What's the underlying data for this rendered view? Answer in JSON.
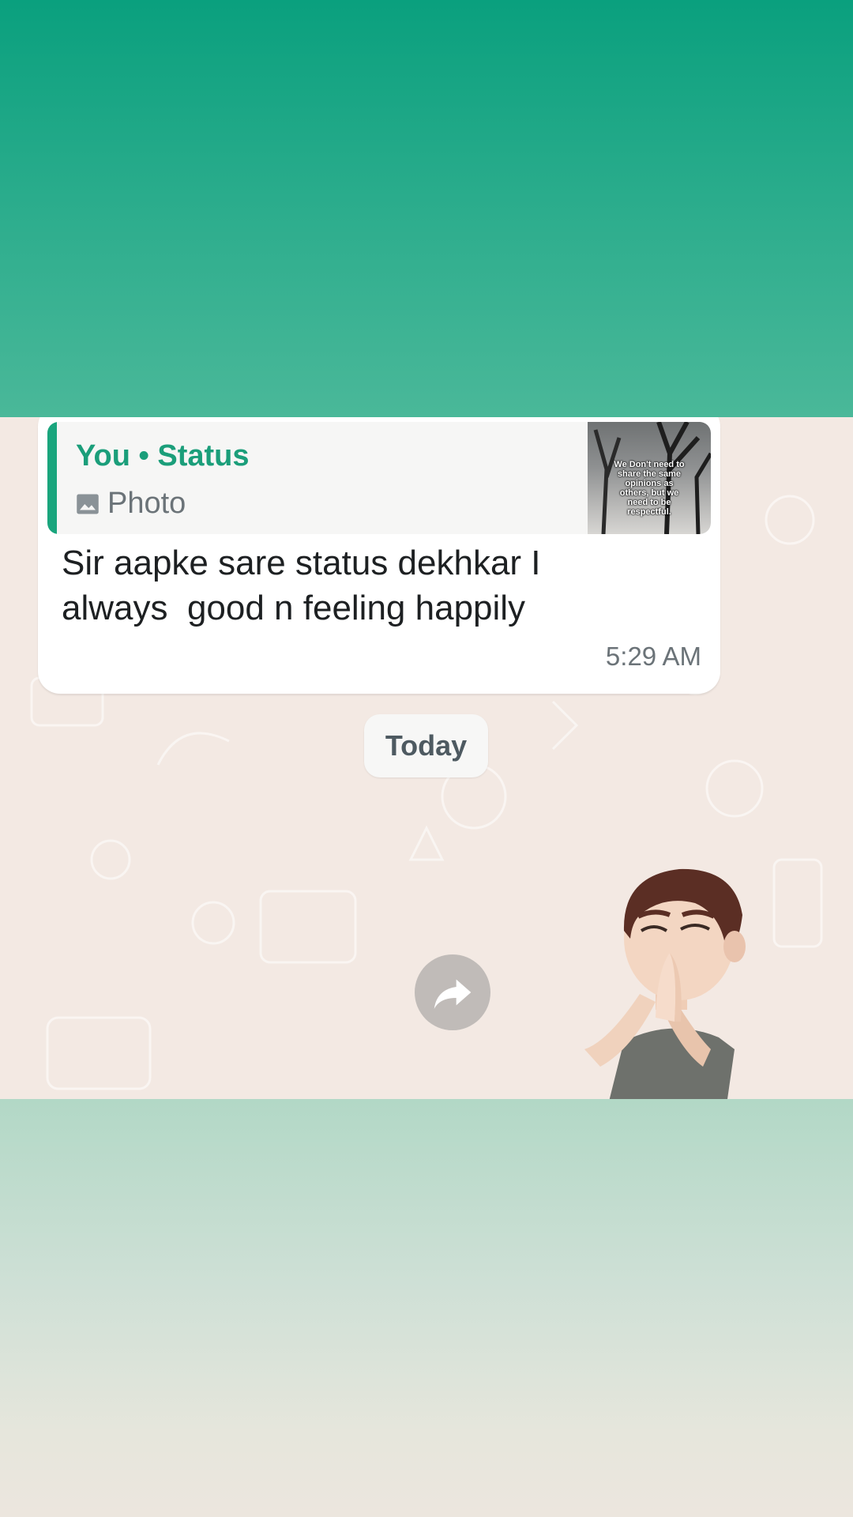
{
  "quoted": {
    "title": "You • Status",
    "subtitle": "Photo",
    "subtitle_icon": "photo-icon",
    "thumbnail_text": "We Don't need to share the same opinions as others, but we need to be respectful."
  },
  "message": {
    "text": "Sir aapke sare status dekhkar I\nalways  good n feeling happily",
    "time": "5:29 AM"
  },
  "date_divider": "Today",
  "forward_icon": "forward-arrow-icon",
  "sticker_icon": "avatar-sticker-namaste",
  "colors": {
    "accent": "#1b9e7a",
    "top_band": "#0aa07e",
    "chat_bg": "#f3e9e3",
    "bubble": "#ffffff"
  }
}
